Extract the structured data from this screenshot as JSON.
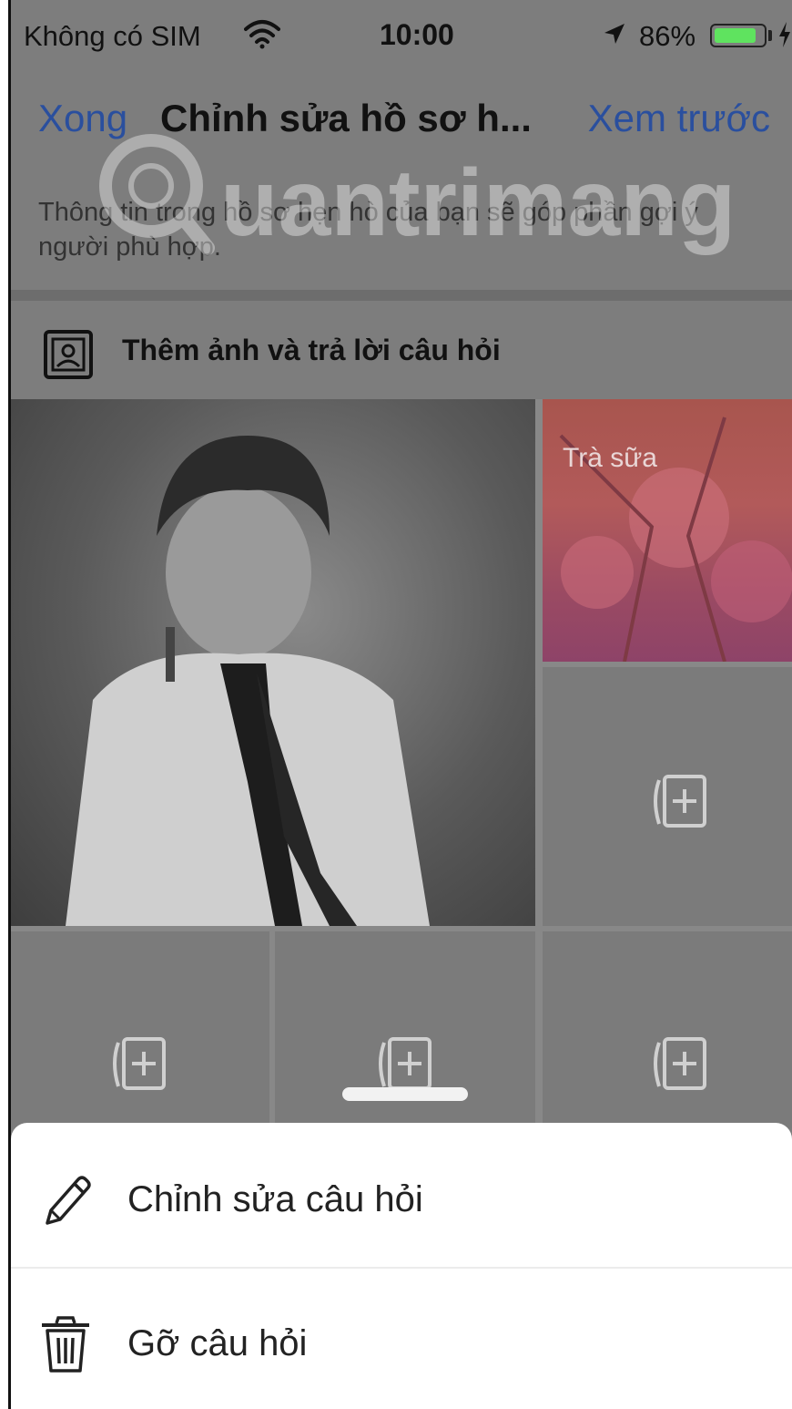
{
  "status_bar": {
    "carrier": "Không có SIM",
    "time": "10:00",
    "battery_percent": "86%",
    "battery_level": 0.86
  },
  "nav": {
    "done_label": "Xong",
    "title": "Chỉnh sửa hồ sơ h...",
    "preview_label": "Xem trước"
  },
  "intro_text": "Thông tin trong hồ sơ hẹn hò của bạn sẽ góp phần gợi ý người phù hợp.",
  "section": {
    "title": "Thêm ảnh và trả lời câu hỏi",
    "icon": "photo-frame-icon"
  },
  "tiles": {
    "question_text": "Trà sữa",
    "add_icon": "add-photo-icon"
  },
  "watermark": {
    "text": "Quantrimang"
  },
  "action_sheet": {
    "items": [
      {
        "label": "Chỉnh sửa câu hỏi",
        "icon": "pencil-icon"
      },
      {
        "label": "Gỡ câu hỏi",
        "icon": "trash-icon"
      }
    ]
  },
  "colors": {
    "link": "#2a4f9e",
    "battery_fill": "#5fe35f",
    "dim_overlay": "#7d7d7d",
    "sheet_bg": "#ffffff"
  }
}
